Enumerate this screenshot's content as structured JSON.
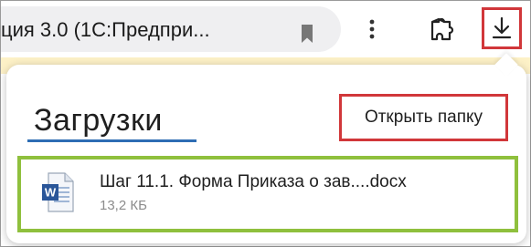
{
  "toolbar": {
    "address_text": "ция 3.0 (1С:Предпри...",
    "bookmark_icon": "bookmark-icon",
    "menu_icon": "more-vertical-icon",
    "extensions_icon": "extensions-icon",
    "download_icon": "download-icon"
  },
  "downloads_panel": {
    "title": "Загрузки",
    "open_folder_label": "Открыть папку",
    "items": [
      {
        "icon": "word-document-icon",
        "name": "Шаг 11.1. Форма Приказа о зав....docx",
        "size": "13,2 КБ"
      }
    ]
  },
  "colors": {
    "highlight_red": "#d1373a",
    "highlight_green": "#8fc03d",
    "title_underline": "#2e6db4",
    "address_bg": "#efeff1"
  }
}
